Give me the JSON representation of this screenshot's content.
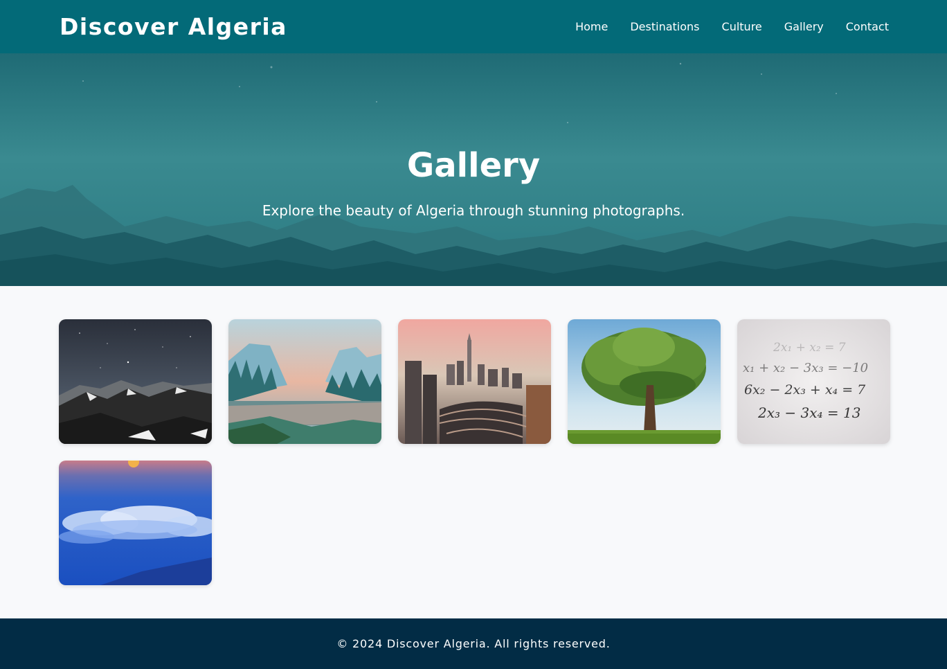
{
  "header": {
    "brand": "Discover Algeria",
    "nav": [
      "Home",
      "Destinations",
      "Culture",
      "Gallery",
      "Contact"
    ]
  },
  "hero": {
    "title": "Gallery",
    "subtitle": "Explore the beauty of Algeria through stunning photographs."
  },
  "gallery": {
    "images": [
      {
        "subject": "starry-mountains"
      },
      {
        "subject": "valley-river-pine-forest"
      },
      {
        "subject": "city-skyline-highways"
      },
      {
        "subject": "lone-tree-meadow"
      },
      {
        "subject": "math-equations"
      },
      {
        "subject": "clouds-blue-dusk"
      }
    ],
    "equations": [
      "2x₁ + x₂ = 7",
      "x₁ + x₂ − 3x₃ = −10",
      "6x₂ − 2x₃ + x₄ = 7",
      "2x₃ − 3x₄ = 13"
    ]
  },
  "footer": {
    "text": "© 2024 Discover Algeria. All rights reserved."
  },
  "colors": {
    "nav": "#036a78",
    "hero": "#2c8088",
    "background": "#f8f9fb",
    "footer": "#022c45"
  }
}
